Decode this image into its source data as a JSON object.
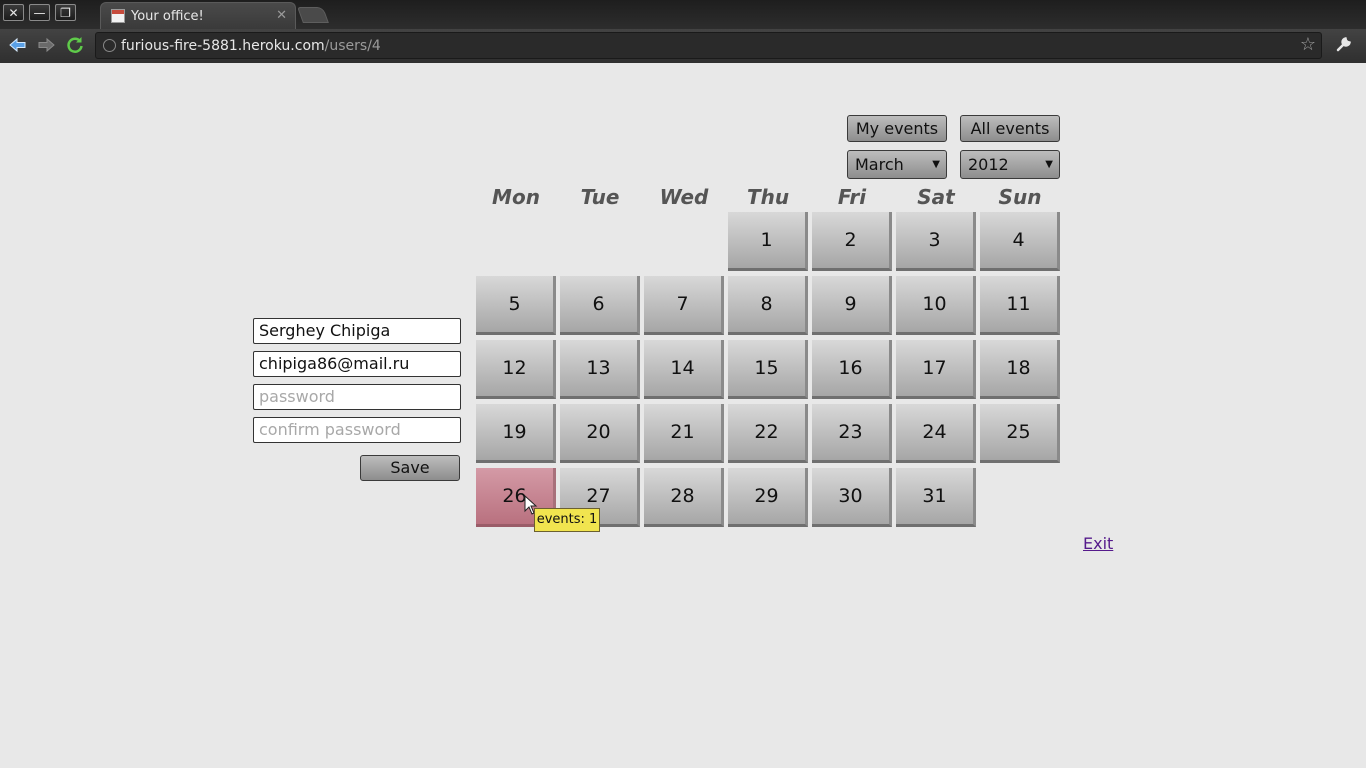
{
  "browser": {
    "window_buttons": {
      "close": "✕",
      "minimize": "—",
      "maximize": "❐"
    },
    "tab": {
      "title": "Your office!",
      "close": "✕"
    },
    "url_host": "furious-fire-5881.heroku.com",
    "url_path": "/users/4"
  },
  "header": {
    "my_events": "My events",
    "all_events": "All events",
    "month": "March",
    "year": "2012"
  },
  "calendar": {
    "weekdays": [
      "Mon",
      "Tue",
      "Wed",
      "Thu",
      "Fri",
      "Sat",
      "Sun"
    ],
    "days": [
      "1",
      "2",
      "3",
      "4",
      "5",
      "6",
      "7",
      "8",
      "9",
      "10",
      "11",
      "12",
      "13",
      "14",
      "15",
      "16",
      "17",
      "18",
      "19",
      "20",
      "21",
      "22",
      "23",
      "24",
      "25",
      "26",
      "27",
      "28",
      "29",
      "30",
      "31"
    ],
    "highlighted_day": "26"
  },
  "profile": {
    "name": "Serghey Chipiga",
    "email": "chipiga86@mail.ru",
    "password_placeholder": "password",
    "confirm_placeholder": "confirm password",
    "save_label": "Save"
  },
  "exit_label": "Exit",
  "tooltip": "events: 1",
  "icons": {
    "back": "back-arrow-icon",
    "forward": "forward-arrow-icon",
    "reload": "reload-icon",
    "bookmark": "star-icon",
    "menu": "wrench-icon"
  },
  "colors": {
    "page_bg": "#e8e8e8",
    "day_cell": "#bdbdbd",
    "highlight_cell": "#c98896",
    "tooltip_bg": "#f1e44f",
    "link": "#551a8b"
  }
}
